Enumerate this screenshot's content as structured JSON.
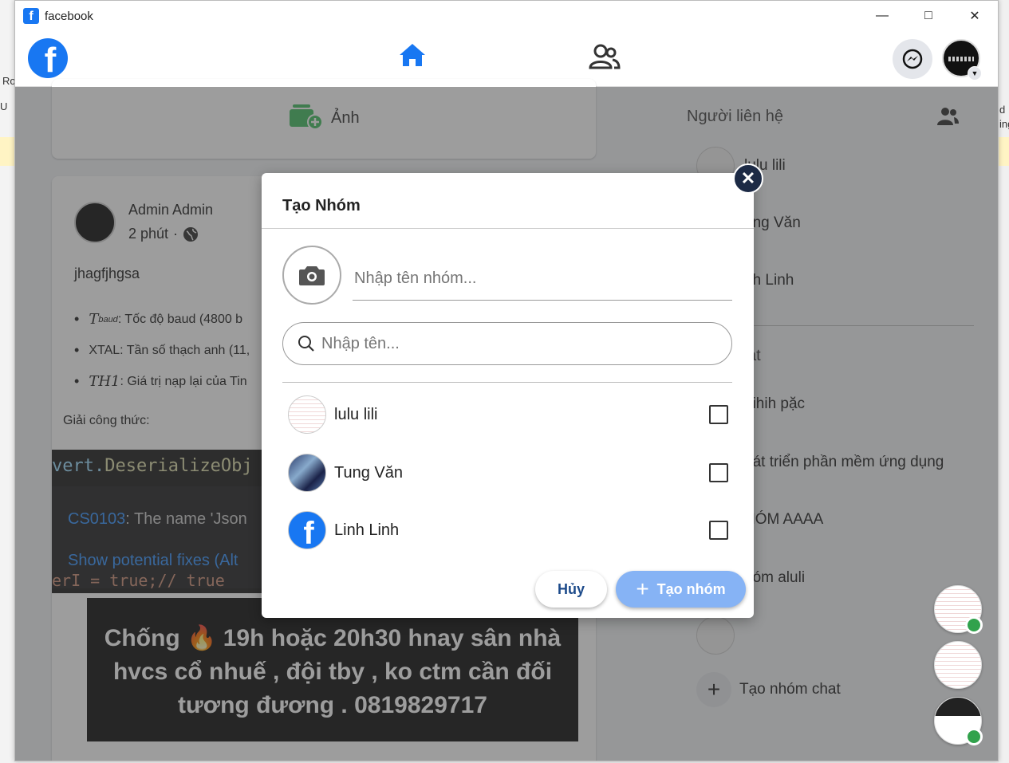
{
  "window": {
    "title": "facebook"
  },
  "background_fragments": [
    "Ro",
    "U",
    "d",
    "ing"
  ],
  "feed": {
    "photo_button_label": "Ảnh",
    "post": {
      "author": "Admin Admin",
      "time": "2 phút",
      "text": "jhagfjhgsa",
      "bullets": [
        {
          "symbol": "T",
          "sub": "baud",
          "text": ": Tốc độ baud (4800 b"
        },
        {
          "symbol": "",
          "sub": "",
          "text": "XTAL: Tần số thạch anh (11,"
        },
        {
          "symbol": "TH1",
          "sub": "",
          "text": ": Giá trị nạp lại của Tin"
        }
      ],
      "formula_label": "Giải công thức:",
      "code": {
        "line1_prefix": "vert.",
        "line1_method": "DeserializeObj",
        "error_code": "CS0103",
        "error_text": ": The name 'Json",
        "fix_text": "Show potential fixes (Alt",
        "last_line": "erI = true;// true"
      },
      "banner_text": "Chống 🔥 19h hoặc 20h30 hnay sân nhà hvcs cổ nhuế , đội tby , ko ctm cần đối tương đương . 0819829717"
    }
  },
  "sidebar": {
    "contacts_title": "Người liên hệ",
    "contacts": [
      {
        "name": "lulu lili"
      },
      {
        "name": "ung Văn"
      },
      {
        "name": "nh Linh"
      }
    ],
    "groups_title": "at",
    "groups": [
      {
        "name": "nihih pặc"
      },
      {
        "name": "hát triển phần mềm ứng dụng"
      },
      {
        "name": "HÓM AAAA"
      },
      {
        "name": "hóm aluli"
      },
      {
        "name": ""
      }
    ],
    "new_group_label": "Tạo nhóm chat"
  },
  "modal": {
    "title": "Tạo Nhóm",
    "group_name_placeholder": "Nhập tên nhóm...",
    "search_placeholder": "Nhập tên...",
    "friends": [
      {
        "name": "lulu lili",
        "checked": false
      },
      {
        "name": "Tung Văn",
        "checked": false
      },
      {
        "name": "Linh Linh",
        "checked": false
      }
    ],
    "cancel_label": "Hủy",
    "create_label": "Tạo nhóm"
  },
  "colors": {
    "brand": "#1877f2",
    "online": "#31a24c",
    "create_button": "#86b3f5",
    "close_button": "#1c2a45"
  }
}
